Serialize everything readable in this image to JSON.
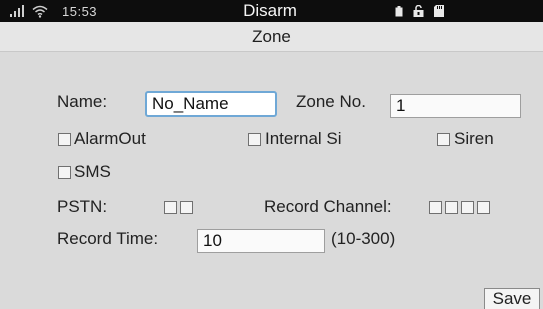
{
  "status_bar": {
    "time": "15:53",
    "title": "Disarm",
    "icons": [
      "signal-icon",
      "wifi-icon",
      "battery-icon",
      "unlock-icon",
      "sd-card-icon"
    ]
  },
  "header": {
    "title": "Zone"
  },
  "form": {
    "name_label": "Name:",
    "name_value": "No_Name",
    "zone_no_label": "Zone No.",
    "zone_no_value": "1",
    "alarm_out_label": "AlarmOut",
    "internal_siren_label": "Internal Si",
    "siren_label": "Siren",
    "sms_label": "SMS",
    "pstn_label": "PSTN:",
    "record_channel_label": "Record Channel:",
    "record_time_label": "Record Time:",
    "record_time_value": "10",
    "record_time_range": "(10-300)",
    "save_label": "Save"
  },
  "colors": {
    "status_bar_bg": "#0d0d0d",
    "focus_border": "#6fa8d6",
    "body_bg": "#dadada"
  }
}
